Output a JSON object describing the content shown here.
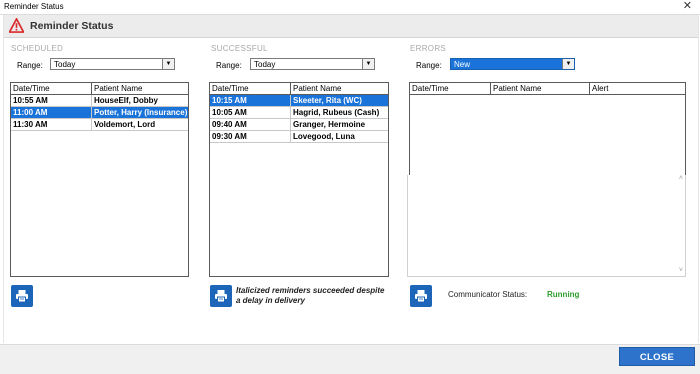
{
  "window": {
    "title": "Reminder Status",
    "close_glyph": "✕"
  },
  "header": {
    "title": "Reminder Status",
    "icon": "warning-triangle-icon"
  },
  "scheduled": {
    "section": "SCHEDULED",
    "range_label": "Range:",
    "range_value": "Today",
    "columns": [
      "Date/Time",
      "Patient Name"
    ],
    "rows": [
      {
        "time": "10:55 AM",
        "name": "HouseElf, Dobby",
        "selected": false
      },
      {
        "time": "11:00 AM",
        "name": "Potter, Harry (Insurance)",
        "selected": true
      },
      {
        "time": "11:30 AM",
        "name": "Voldemort, Lord",
        "selected": false
      }
    ]
  },
  "successful": {
    "section": "SUCCESSFUL",
    "range_label": "Range:",
    "range_value": "Today",
    "columns": [
      "Date/Time",
      "Patient Name"
    ],
    "rows": [
      {
        "time": "10:15 AM",
        "name": "Skeeter, Rita (WC)",
        "selected": true
      },
      {
        "time": "10:05 AM",
        "name": "Hagrid, Rubeus (Cash)",
        "selected": false
      },
      {
        "time": "09:40 AM",
        "name": "Granger, Hermoine",
        "selected": false
      },
      {
        "time": "09:30 AM",
        "name": "Lovegood, Luna",
        "selected": false
      }
    ],
    "note": "Italicized reminders succeeded despite a delay in delivery"
  },
  "errors": {
    "section": "ERRORS",
    "range_label": "Range:",
    "range_value": "New",
    "columns": [
      "Date/Time",
      "Patient Name",
      "Alert"
    ],
    "rows": []
  },
  "communicator": {
    "label": "Communicator Status:",
    "value": "Running",
    "color": "#2e9e2e"
  },
  "footer": {
    "close_label": "CLOSE"
  },
  "colors": {
    "accent": "#1a73d9",
    "button": "#1d65b8"
  }
}
